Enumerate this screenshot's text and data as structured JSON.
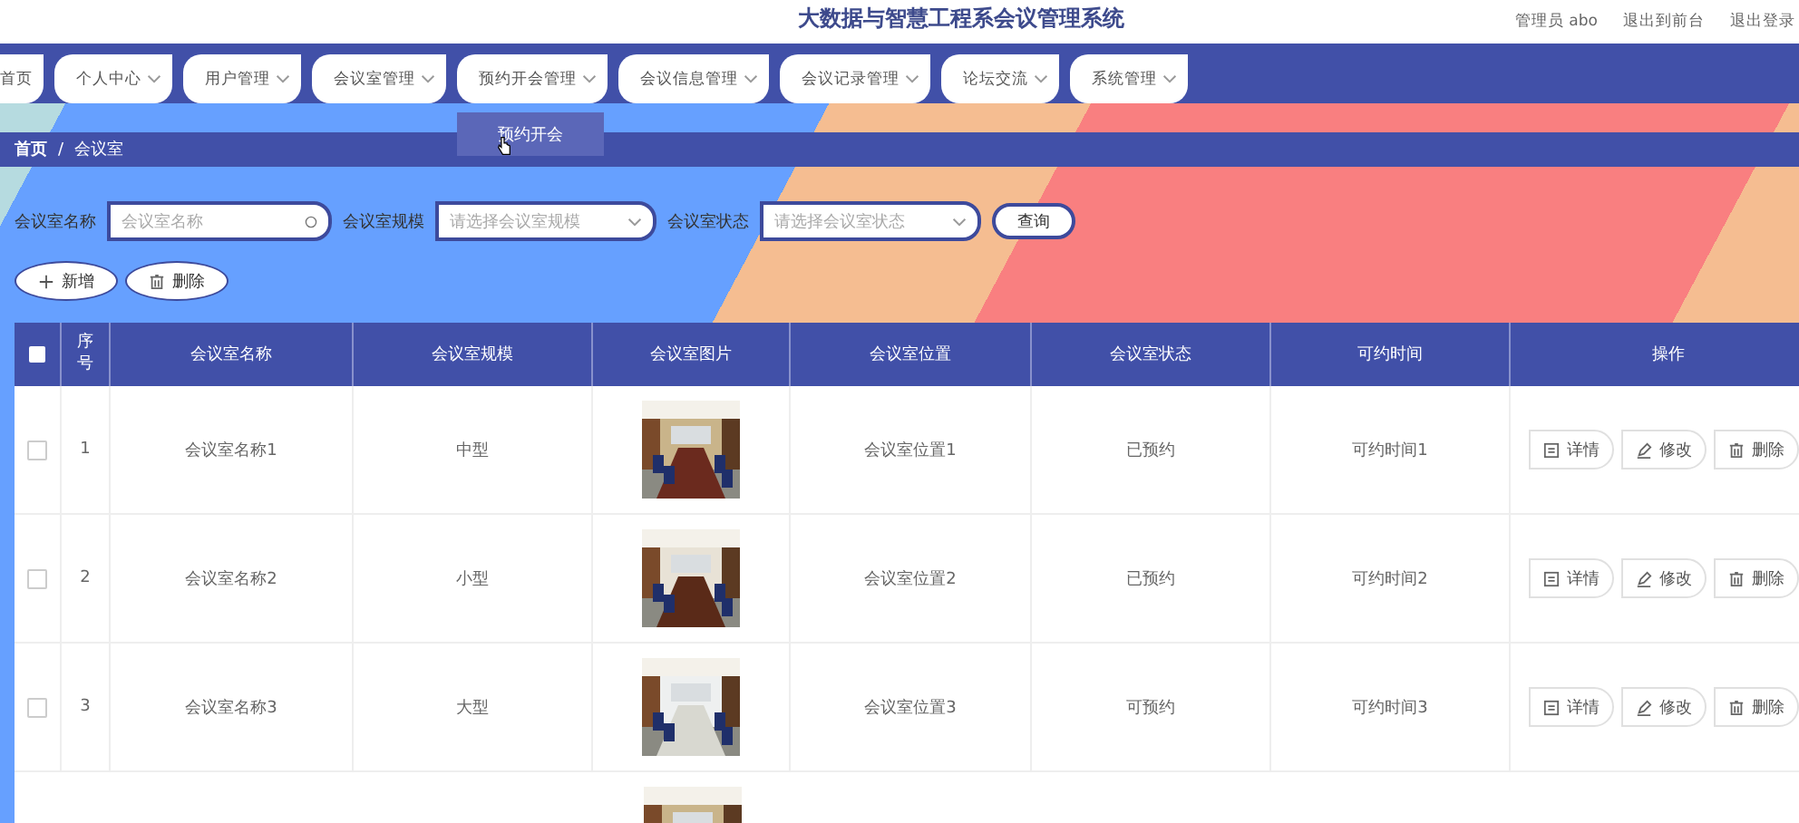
{
  "header": {
    "title": "大数据与智慧工程系会议管理系统",
    "user": "管理员 abo",
    "links": [
      "退出到前台",
      "退出登录"
    ]
  },
  "nav": [
    {
      "label": "首页",
      "has_menu": false
    },
    {
      "label": "个人中心",
      "has_menu": true
    },
    {
      "label": "用户管理",
      "has_menu": true
    },
    {
      "label": "会议室管理",
      "has_menu": true
    },
    {
      "label": "预约开会管理",
      "has_menu": true,
      "children": [
        "预约开会"
      ]
    },
    {
      "label": "会议信息管理",
      "has_menu": true
    },
    {
      "label": "会议记录管理",
      "has_menu": true
    },
    {
      "label": "论坛交流",
      "has_menu": true
    },
    {
      "label": "系统管理",
      "has_menu": true
    }
  ],
  "breadcrumb": {
    "separator": "/",
    "items": [
      "首页",
      "会议室"
    ]
  },
  "search": [
    {
      "label": "会议室名称",
      "kind": "text",
      "placeholder": "会议室名称"
    },
    {
      "label": "会议室规模",
      "kind": "select",
      "placeholder": "请选择会议室规模"
    },
    {
      "label": "会议室状态",
      "kind": "select",
      "placeholder": "请选择会议室状态"
    }
  ],
  "search_button": "查询",
  "toolbar": [
    {
      "label": "新增",
      "kind": "add"
    },
    {
      "label": "删除",
      "kind": "delete"
    }
  ],
  "table": {
    "select_all_checked": false,
    "columns": [
      "序号",
      "会议室名称",
      "会议室规模",
      "会议室图片",
      "会议室位置",
      "会议室状态",
      "可约时间",
      "操作"
    ],
    "rows": [
      {
        "checked": false,
        "index": "1",
        "name": "会议室名称1",
        "scale": "中型",
        "picture": {
          "kind": "picture"
        },
        "location": "会议室位置1",
        "status": "已预约",
        "time": "可约时间1",
        "actions": [
          {
            "label": "详情",
            "kind": "detail"
          },
          {
            "label": "修改",
            "kind": "edit"
          },
          {
            "label": "删除",
            "kind": "delete"
          }
        ]
      },
      {
        "checked": false,
        "index": "2",
        "name": "会议室名称2",
        "scale": "小型",
        "picture": {
          "kind": "picture"
        },
        "location": "会议室位置2",
        "status": "已预约",
        "time": "可约时间2",
        "actions": [
          {
            "label": "详情",
            "kind": "detail"
          },
          {
            "label": "修改",
            "kind": "edit"
          },
          {
            "label": "删除",
            "kind": "delete"
          }
        ]
      },
      {
        "checked": false,
        "index": "3",
        "name": "会议室名称3",
        "scale": "大型",
        "picture": {
          "kind": "picture"
        },
        "location": "会议室位置3",
        "status": "可预约",
        "time": "可约时间3",
        "actions": [
          {
            "label": "详情",
            "kind": "detail"
          },
          {
            "label": "修改",
            "kind": "edit"
          },
          {
            "label": "删除",
            "kind": "delete"
          }
        ]
      }
    ],
    "partial_row": {
      "picture": {
        "kind": "picture"
      }
    }
  }
}
